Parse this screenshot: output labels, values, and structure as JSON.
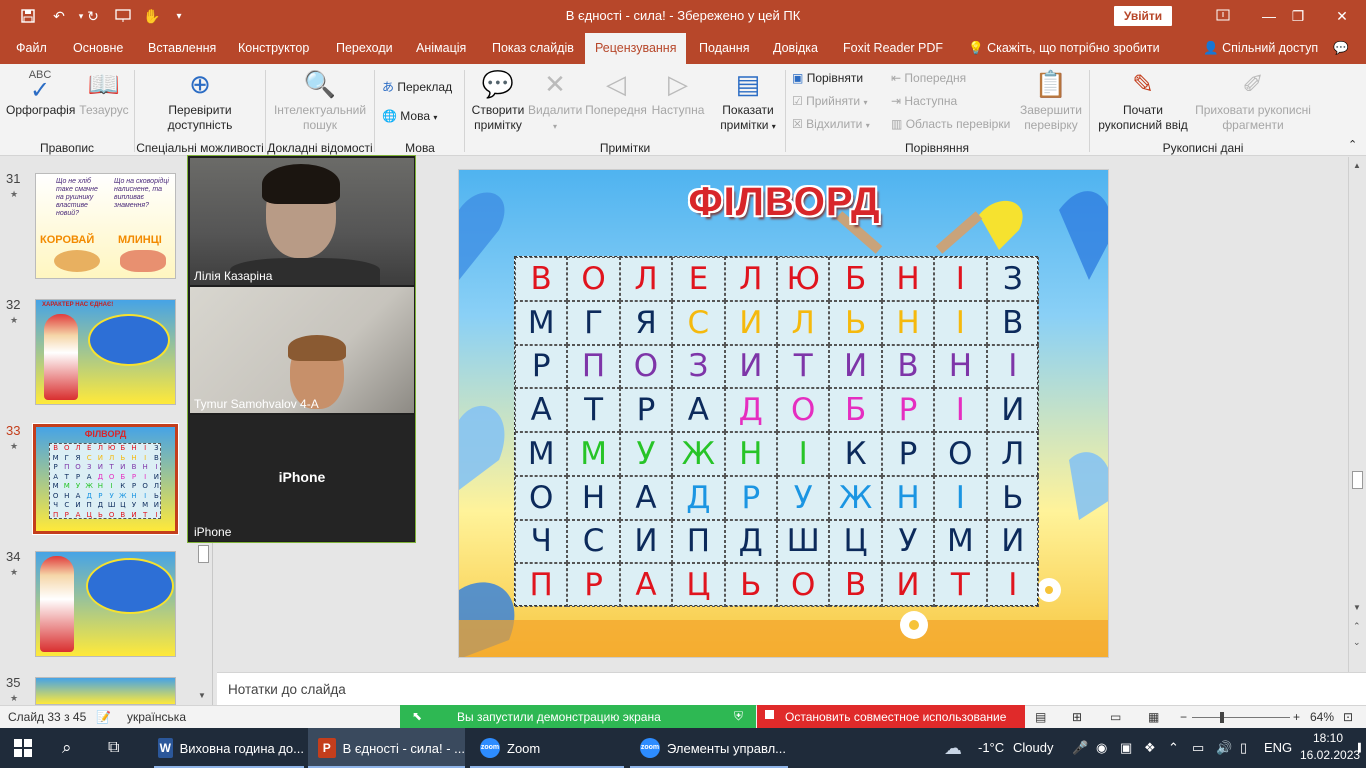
{
  "window": {
    "title": "В єдності - сила!  -  Збережено у цей ПК",
    "signin_label": "Увійти",
    "qat": [
      "save-icon",
      "undo-icon",
      "redo-icon",
      "present-icon",
      "touch-mode-icon",
      "customize-icon"
    ]
  },
  "tabs": [
    {
      "label": "Файл"
    },
    {
      "label": "Основне"
    },
    {
      "label": "Вставлення"
    },
    {
      "label": "Конструктор"
    },
    {
      "label": "Переходи"
    },
    {
      "label": "Анімація"
    },
    {
      "label": "Показ слайдів"
    },
    {
      "label": "Рецензування",
      "active": true
    },
    {
      "label": "Подання"
    },
    {
      "label": "Довідка"
    },
    {
      "label": "Foxit Reader PDF"
    }
  ],
  "tellme": "Скажіть, що потрібно зробити",
  "share_label": "Спільний доступ",
  "ribbon": {
    "spelling": "Орфографія",
    "thesaurus": "Тезаурус",
    "check_access_1": "Перевірити",
    "check_access_2": "доступність",
    "smart_1": "Інтелектуальний",
    "smart_2": "пошук",
    "translate": "Переклад",
    "language": "Мова",
    "new_comment_1": "Створити",
    "new_comment_2": "примітку",
    "delete": "Видалити",
    "previous": "Попередня",
    "next": "Наступна",
    "show_comments_1": "Показати",
    "show_comments_2": "примітки",
    "compare": "Порівняти",
    "accept": "Прийняти",
    "reject": "Відхилити",
    "cmp_prev": "Попередня",
    "cmp_next": "Наступна",
    "review_pane": "Область перевірки",
    "end_review_1": "Завершити",
    "end_review_2": "перевірку",
    "ink_start_1": "Почати",
    "ink_start_2": "рукописний ввід",
    "hide_ink_1": "Приховати рукописні",
    "hide_ink_2": "фрагменти",
    "groups": {
      "proofing": "Правопис",
      "accessibility": "Спеціальні можливості",
      "insights": "Докладні відомості",
      "language": "Мова",
      "comments": "Примітки",
      "compare": "Порівняння",
      "ink": "Рукописні дані"
    }
  },
  "thumbnails": [
    {
      "num": "31",
      "label": "Що не хліб так щось ... КОРОВАЙ МЛИНЦІ"
    },
    {
      "num": "32",
      "label": "ХАРАКТЕР НАС ЄДНАЄ"
    },
    {
      "num": "33",
      "label": "ФІЛВОРД",
      "selected": true
    },
    {
      "num": "34",
      "label": ""
    },
    {
      "num": "35",
      "label": ""
    }
  ],
  "thumb_star": "★",
  "thumb_texts": {
    "t31a": "Що не хліб таке смачне на рушнику властиве новий?",
    "t31b": "Що на сковорідці налиснене, та випливає знамення?",
    "t31c": "КОРОВАЙ",
    "t31d": "МЛИНЦІ",
    "t32": "ХАРАКТЕР НАС ЄДНАЄ!",
    "t33": "ФІЛВОРД"
  },
  "video": {
    "participants": [
      {
        "name": "Лілія Казаріна"
      },
      {
        "name": "Tymur Samohvalov 4-А"
      },
      {
        "name": "iPhone",
        "center_label": "iPhone"
      }
    ]
  },
  "slide": {
    "title": "ФІЛВОРД",
    "colors": {
      "r": "#e0141e",
      "n": "#0c2a5b",
      "y": "#f5b90d",
      "p": "#7e35a8",
      "m": "#e52ec0",
      "g": "#27c427",
      "b": "#1b95e2"
    },
    "rows": [
      [
        "В",
        "О",
        "Л",
        "Е",
        "Л",
        "Ю",
        "Б",
        "Н",
        "І",
        "З"
      ],
      [
        "М",
        "Г",
        "Я",
        "С",
        "И",
        "Л",
        "Ь",
        "Н",
        "І",
        "В"
      ],
      [
        "Р",
        "П",
        "О",
        "З",
        "И",
        "Т",
        "И",
        "В",
        "Н",
        "І"
      ],
      [
        "А",
        "Т",
        "Р",
        "А",
        "Д",
        "О",
        "Б",
        "Р",
        "І",
        "И"
      ],
      [
        "М",
        "М",
        "У",
        "Ж",
        "Н",
        "І",
        "К",
        "Р",
        "О",
        "Л"
      ],
      [
        "О",
        "Н",
        "А",
        "Д",
        "Р",
        "У",
        "Ж",
        "Н",
        "І",
        "Ь"
      ],
      [
        "Ч",
        "С",
        "И",
        "П",
        "Д",
        "Ш",
        "Ц",
        "У",
        "М",
        "И"
      ],
      [
        "П",
        "Р",
        "А",
        "Ц",
        "Ь",
        "О",
        "В",
        "И",
        "Т",
        "І"
      ]
    ],
    "row_colors": [
      [
        "r",
        "r",
        "r",
        "r",
        "r",
        "r",
        "r",
        "r",
        "r",
        "n"
      ],
      [
        "n",
        "n",
        "n",
        "y",
        "y",
        "y",
        "y",
        "y",
        "y",
        "n"
      ],
      [
        "n",
        "p",
        "p",
        "p",
        "p",
        "p",
        "p",
        "p",
        "p",
        "p"
      ],
      [
        "n",
        "n",
        "n",
        "n",
        "m",
        "m",
        "m",
        "m",
        "m",
        "n"
      ],
      [
        "n",
        "g",
        "g",
        "g",
        "g",
        "g",
        "n",
        "n",
        "n",
        "n"
      ],
      [
        "n",
        "n",
        "n",
        "b",
        "b",
        "b",
        "b",
        "b",
        "b",
        "n"
      ],
      [
        "n",
        "n",
        "n",
        "n",
        "n",
        "n",
        "n",
        "n",
        "n",
        "n"
      ],
      [
        "r",
        "r",
        "r",
        "r",
        "r",
        "r",
        "r",
        "r",
        "r",
        "r"
      ]
    ]
  },
  "notes_placeholder": "Нотатки до слайда",
  "status": {
    "slide_info": "Слайд 33 з 45",
    "language": "українська",
    "screen_share": "Вы запустили демонстрацию экрана",
    "stop_share": "Остановить совместное использование",
    "zoom": "64%",
    "zoom_level": 0.64
  },
  "taskbar": {
    "apps": [
      {
        "label": "Виховна година до...",
        "icon": "word-icon"
      },
      {
        "label": "В єдності - сила! - ...",
        "icon": "powerpoint-icon",
        "active": true
      },
      {
        "label": "Zoom",
        "icon": "zoom-icon"
      },
      {
        "label": "Элементы управл...",
        "icon": "zoom-icon"
      }
    ],
    "weather_temp": "-1°C",
    "weather_desc": "Cloudy",
    "lang": "ENG",
    "time": "18:10",
    "date": "16.02.2023"
  }
}
